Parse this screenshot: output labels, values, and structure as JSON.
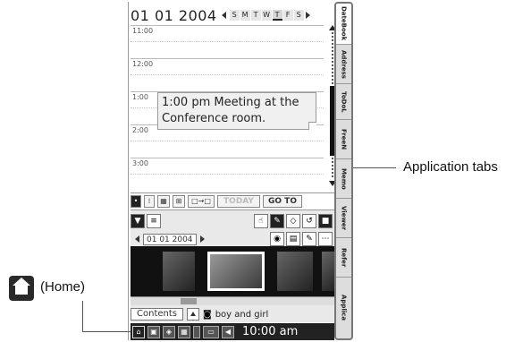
{
  "datebar": {
    "date": "01 01 2004",
    "days": [
      "S",
      "M",
      "T",
      "W",
      "T",
      "F",
      "S"
    ],
    "today_index": 4
  },
  "timeline": {
    "slots": [
      "11:00",
      "12:00",
      "1:00",
      "2:00",
      "3:00"
    ],
    "event": "1:00 pm  Meeting at the Conference room."
  },
  "viewbar": {
    "today_label": "TODAY",
    "goto_label": "GO TO"
  },
  "lower": {
    "pic_date": "01 01 2004",
    "contents_label": "Contents",
    "caption": "boy and girl"
  },
  "statusbar": {
    "time": "10:00 am"
  },
  "tabs": [
    {
      "label": "DateBook",
      "active": true
    },
    {
      "label": "Address",
      "active": false
    },
    {
      "label": "ToDoL",
      "active": false
    },
    {
      "label": "FreeN",
      "active": false
    },
    {
      "label": "Memo",
      "active": false
    },
    {
      "label": "Viewer",
      "active": false
    },
    {
      "label": "Refer",
      "active": false
    },
    {
      "label": "Applica",
      "active": false
    }
  ],
  "annotations": {
    "application_tabs": "Application tabs",
    "home": "(Home)"
  }
}
